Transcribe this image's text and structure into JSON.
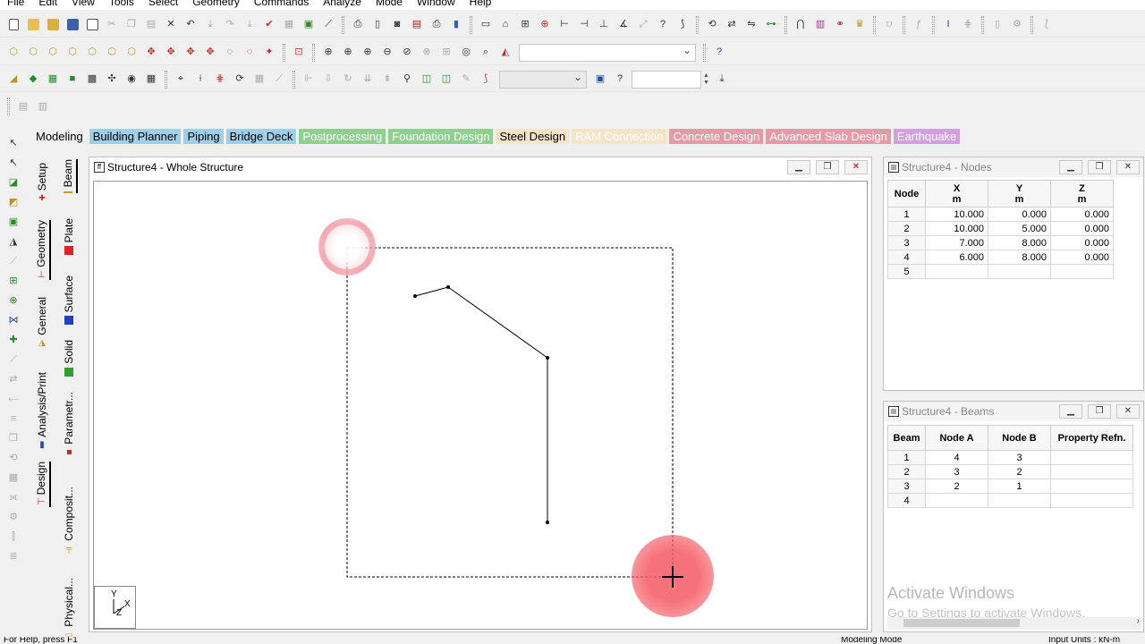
{
  "menu": [
    "File",
    "Edit",
    "View",
    "Tools",
    "Select",
    "Geometry",
    "Commands",
    "Analyze",
    "Mode",
    "Window",
    "Help"
  ],
  "mode_tabs": [
    {
      "label": "Modeling",
      "bg": "",
      "color": "#000000"
    },
    {
      "label": "Building Planner",
      "bg": "#9fd0e8",
      "color": "#000000"
    },
    {
      "label": "Piping",
      "bg": "#9fd0e8",
      "color": "#000000"
    },
    {
      "label": "Bridge Deck",
      "bg": "#9fd0e8",
      "color": "#000000"
    },
    {
      "label": "Postprocessing",
      "bg": "#8fcf8f",
      "color": "#ffffff"
    },
    {
      "label": "Foundation Design",
      "bg": "#8fcf8f",
      "color": "#ffffff"
    },
    {
      "label": "Steel Design",
      "bg": "#f4e4c8",
      "color": "#000000"
    },
    {
      "label": "RAM Connection",
      "bg": "#f4e4c8",
      "color": "#ffffff"
    },
    {
      "label": "Concrete Design",
      "bg": "#e79aa6",
      "color": "#ffffff"
    },
    {
      "label": "Advanced Slab Design",
      "bg": "#e79aa6",
      "color": "#ffffff"
    },
    {
      "label": "Earthquake",
      "bg": "#d49ee3",
      "color": "#ffffff"
    }
  ],
  "page_control": {
    "outer": [
      "Setup",
      "Geometry",
      "General",
      "Analysis/Print",
      "Design"
    ],
    "inner": [
      "Beam",
      "Plate",
      "Surface",
      "Solid",
      "Parametr...",
      "Composit...",
      "Physical..."
    ]
  },
  "structure_window": {
    "title": "Structure4 - Whole Structure",
    "axis_labels": [
      "Y",
      "X",
      "Z"
    ]
  },
  "nodes_window": {
    "title": "Structure4 - Nodes",
    "headers": [
      "Node",
      "X",
      "Y",
      "Z"
    ],
    "units": [
      "",
      "m",
      "m",
      "m"
    ],
    "rows": [
      [
        "1",
        "10.000",
        "0.000",
        "0.000"
      ],
      [
        "2",
        "10.000",
        "5.000",
        "0.000"
      ],
      [
        "3",
        "7.000",
        "8.000",
        "0.000"
      ],
      [
        "4",
        "6.000",
        "8.000",
        "0.000"
      ],
      [
        "5",
        "",
        "",
        ""
      ]
    ]
  },
  "beams_window": {
    "title": "Structure4 - Beams",
    "headers": [
      "Beam",
      "Node A",
      "Node B",
      "Property Refn."
    ],
    "rows": [
      [
        "1",
        "4",
        "3",
        ""
      ],
      [
        "2",
        "3",
        "2",
        ""
      ],
      [
        "3",
        "2",
        "1",
        ""
      ],
      [
        "4",
        "",
        "",
        ""
      ]
    ]
  },
  "watermark": {
    "line1": "Activate Windows",
    "line2": "Go to Settings to activate Windows."
  },
  "status": {
    "left": "For Help, press F1",
    "mid": "Modeling Mode",
    "right": "Input Units : kN-m"
  }
}
